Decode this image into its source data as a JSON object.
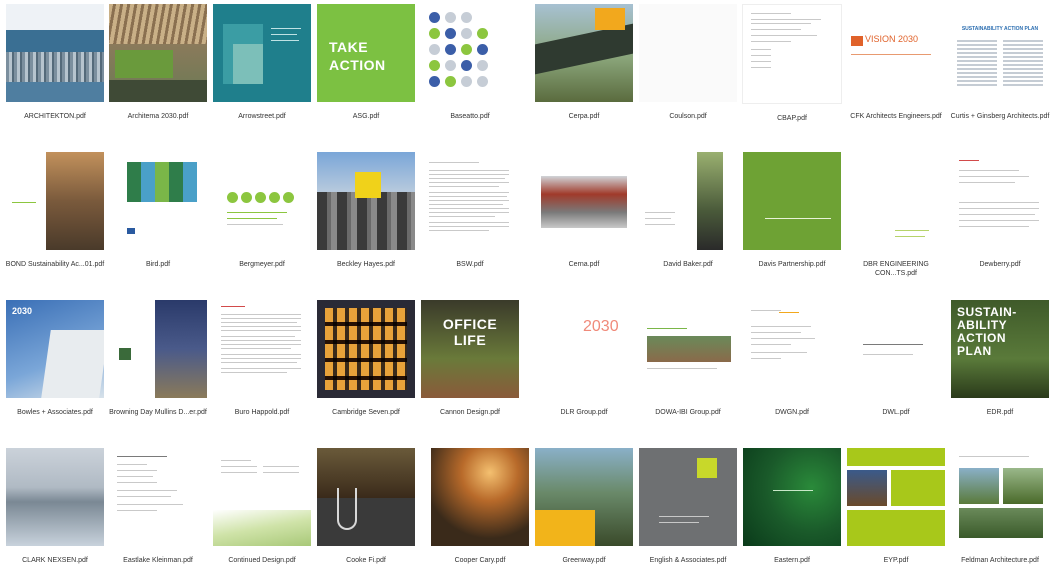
{
  "files": [
    {
      "name": "ARCHITEKTON.pdf",
      "thumb_text": ""
    },
    {
      "name": "Architema 2030.pdf",
      "thumb_text": ""
    },
    {
      "name": "Arrowstreet.pdf",
      "thumb_text": ""
    },
    {
      "name": "ASG.pdf",
      "thumb_text": "TAKE\nACTION"
    },
    {
      "name": "Baseatto.pdf",
      "thumb_text": ""
    },
    {
      "name": "Cerpa.pdf",
      "thumb_text": ""
    },
    {
      "name": "Coulson.pdf",
      "thumb_text": ""
    },
    {
      "name": "CBAP.pdf",
      "thumb_text": ""
    },
    {
      "name": "CFK Architects Engineers.pdf",
      "thumb_text": "VISION 2030"
    },
    {
      "name": "Curtis + Ginsberg Architects.pdf",
      "thumb_text": "SUSTAINABILITY ACTION PLAN"
    },
    {
      "name": "BOND Sustainability Ac...01.pdf",
      "thumb_text": ""
    },
    {
      "name": "Bird.pdf",
      "thumb_text": ""
    },
    {
      "name": "Bergmeyer.pdf",
      "thumb_text": ""
    },
    {
      "name": "Beckley Hayes.pdf",
      "thumb_text": ""
    },
    {
      "name": "BSW.pdf",
      "thumb_text": ""
    },
    {
      "name": "Cerna.pdf",
      "thumb_text": ""
    },
    {
      "name": "David Baker.pdf",
      "thumb_text": ""
    },
    {
      "name": "Davis Partnership.pdf",
      "thumb_text": ""
    },
    {
      "name": "DBR ENGINEERING CON...TS.pdf",
      "thumb_text": ""
    },
    {
      "name": "Dewberry.pdf",
      "thumb_text": ""
    },
    {
      "name": "Bowles + Associates.pdf",
      "thumb_text": "2030"
    },
    {
      "name": "Browning Day Mullins D...er.pdf",
      "thumb_text": ""
    },
    {
      "name": "Buro Happold.pdf",
      "thumb_text": ""
    },
    {
      "name": "Cambridge Seven.pdf",
      "thumb_text": ""
    },
    {
      "name": "Cannon Design.pdf",
      "thumb_text": "OFFICE\nLIFE"
    },
    {
      "name": "DLR Group.pdf",
      "thumb_text": "2030"
    },
    {
      "name": "DOWA-IBI Group.pdf",
      "thumb_text": ""
    },
    {
      "name": "DWGN.pdf",
      "thumb_text": ""
    },
    {
      "name": "DWL.pdf",
      "thumb_text": ""
    },
    {
      "name": "EDR.pdf",
      "thumb_text": "SUSTAIN-\nABILITY\nACTION\nPLAN"
    },
    {
      "name": "CLARK NEXSEN.pdf",
      "thumb_text": ""
    },
    {
      "name": "Eastlake Kleinman.pdf",
      "thumb_text": ""
    },
    {
      "name": "Continued Design.pdf",
      "thumb_text": ""
    },
    {
      "name": "Cooke Fi.pdf",
      "thumb_text": ""
    },
    {
      "name": "Cooper Cary.pdf",
      "thumb_text": ""
    },
    {
      "name": "Greenway.pdf",
      "thumb_text": ""
    },
    {
      "name": "English & Associates.pdf",
      "thumb_text": ""
    },
    {
      "name": "Eastern.pdf",
      "thumb_text": ""
    },
    {
      "name": "EYP.pdf",
      "thumb_text": ""
    },
    {
      "name": "Feldman Architecture.pdf",
      "thumb_text": ""
    }
  ]
}
